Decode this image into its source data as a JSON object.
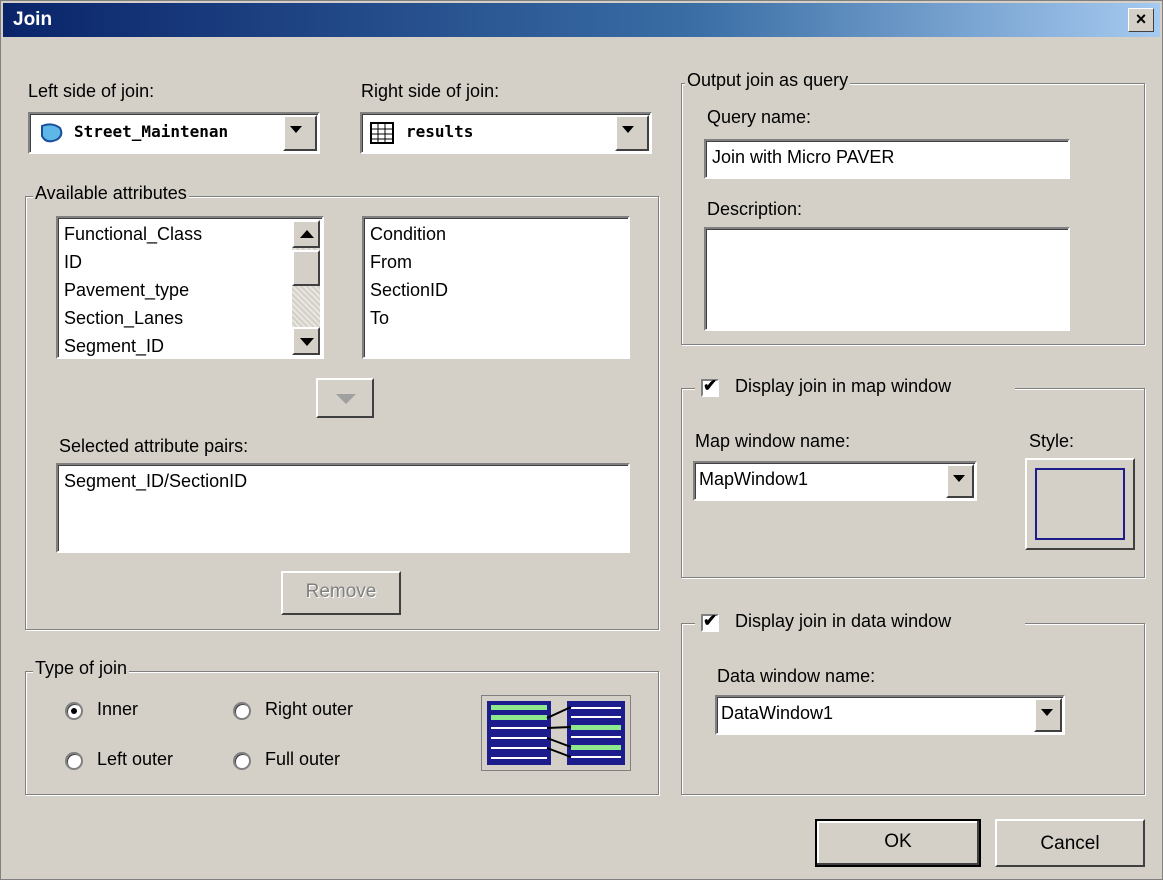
{
  "window": {
    "title": "Join",
    "close_label": "×"
  },
  "left_side": {
    "label": "Left side of join:",
    "value": "Street_Maintenan"
  },
  "right_side": {
    "label": "Right side of join:",
    "value": "results"
  },
  "available_attributes": {
    "legend": "Available attributes",
    "left_items": [
      "Functional_Class",
      "ID",
      "Pavement_type",
      "Section_Lanes",
      "Segment_ID"
    ],
    "right_items": [
      "Condition",
      "From",
      "SectionID",
      "To"
    ]
  },
  "selected_pairs": {
    "label": "Selected attribute pairs:",
    "items": [
      "Segment_ID/SectionID"
    ]
  },
  "remove_button": {
    "label": "Remove"
  },
  "join_type": {
    "legend": "Type of join",
    "inner": "Inner",
    "right_outer": "Right outer",
    "left_outer": "Left outer",
    "full_outer": "Full outer",
    "selected": "Inner"
  },
  "output_query": {
    "legend": "Output join as query",
    "query_name_label": "Query name:",
    "query_name_value": "Join with Micro PAVER",
    "description_label": "Description:",
    "description_value": ""
  },
  "map_window": {
    "checkbox_label": "Display join in map window",
    "checked": true,
    "name_label": "Map window name:",
    "name_value": "MapWindow1",
    "style_label": "Style:"
  },
  "data_window": {
    "checkbox_label": "Display join in data window",
    "checked": true,
    "name_label": "Data window name:",
    "name_value": "DataWindow1"
  },
  "buttons": {
    "ok": "OK",
    "cancel": "Cancel"
  },
  "colors": {
    "title_start": "#0a246a",
    "title_end": "#a6caf0",
    "face": "#d4d0c8",
    "join_diagram_blue": "#1c1c8c",
    "join_diagram_green": "#8ee88e"
  }
}
